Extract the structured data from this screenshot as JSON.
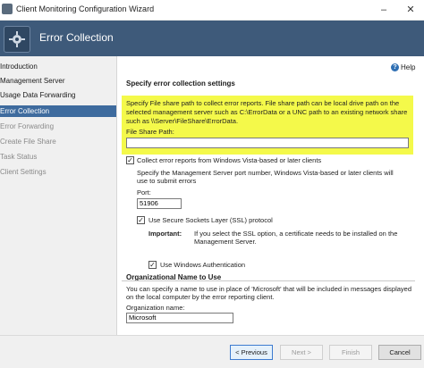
{
  "window": {
    "title": "Client Monitoring Configuration Wizard"
  },
  "header": {
    "title": "Error Collection"
  },
  "sidebar": {
    "items": [
      {
        "label": "Introduction",
        "state": "normal"
      },
      {
        "label": "Management Server",
        "state": "normal"
      },
      {
        "label": "Usage Data Forwarding",
        "state": "normal"
      },
      {
        "label": "Error Collection",
        "state": "active"
      },
      {
        "label": "Error Forwarding",
        "state": "dim"
      },
      {
        "label": "Create File Share",
        "state": "dim"
      },
      {
        "label": "Task Status",
        "state": "dim"
      },
      {
        "label": "Client Settings",
        "state": "dim"
      }
    ]
  },
  "main": {
    "help_label": "Help",
    "section_title": "Specify error collection settings",
    "description": "Specify File share path to collect error reports. File share path can be local drive path on the selected management server such as C:\\ErrorData or a UNC path to an existing network share such as \\\\Server\\FileShare\\ErrorData.",
    "file_share_label": "File Share Path:",
    "file_share_value": "",
    "collect_vista_label": "Collect error reports from Windows Vista-based or later clients",
    "collect_vista_checked": true,
    "vista_description": "Specify the Management Server port number, Windows Vista-based or later clients will use to submit errors",
    "port_label": "Port:",
    "port_value": "51906",
    "ssl_label": "Use Secure Sockets Layer (SSL) protocol",
    "ssl_checked": true,
    "important_label": "Important:",
    "important_text": "If you select the SSL option, a certificate needs to be installed on the Management Server.",
    "windows_auth_label": "Use Windows Authentication",
    "windows_auth_checked": true,
    "org_group_title": "Organizational Name to Use",
    "org_description": "You can specify a name to use in place of 'Microsoft' that will be included in messages displayed on the local computer by the error reporting client.",
    "org_name_label": "Organization name:",
    "org_name_value": "Microsoft"
  },
  "footer": {
    "previous_label": "< Previous",
    "next_label": "Next >",
    "finish_label": "Finish",
    "cancel_label": "Cancel"
  },
  "colors": {
    "header_bg": "#3e5a7a",
    "active_item": "#3e6b9e",
    "highlight": "#f4f94a"
  }
}
